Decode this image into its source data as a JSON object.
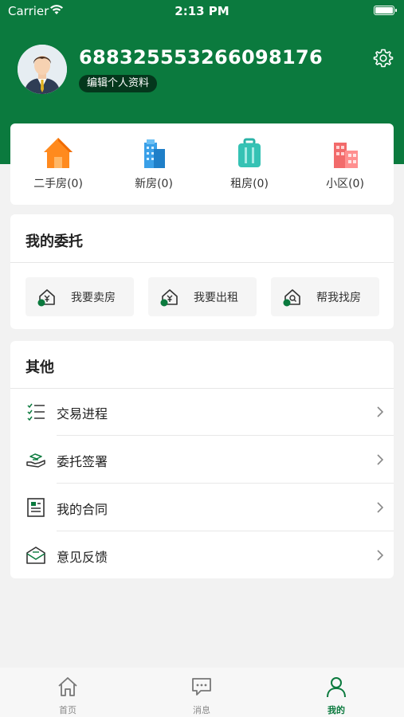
{
  "status_bar": {
    "carrier": "Carrier",
    "time": "2:13 PM"
  },
  "profile": {
    "user_id": "68832555326609817​6",
    "edit_label": "编辑个人资料"
  },
  "stats": [
    {
      "label": "二手房(0)",
      "icon": "house-icon"
    },
    {
      "label": "新房(0)",
      "icon": "building-icon"
    },
    {
      "label": "租房(0)",
      "icon": "suitcase-icon"
    },
    {
      "label": "小区(0)",
      "icon": "community-icon"
    }
  ],
  "entrust": {
    "title": "我的委托",
    "buttons": [
      {
        "label": "我要卖房"
      },
      {
        "label": "我要出租"
      },
      {
        "label": "帮我找房"
      }
    ]
  },
  "other": {
    "title": "其他",
    "items": [
      {
        "label": "交易进程",
        "icon": "checklist-icon"
      },
      {
        "label": "委托签署",
        "icon": "hand-icon"
      },
      {
        "label": "我的合同",
        "icon": "contract-icon"
      },
      {
        "label": "意见反馈",
        "icon": "mail-icon"
      }
    ]
  },
  "tabbar": [
    {
      "label": "首页",
      "icon": "home-icon"
    },
    {
      "label": "消息",
      "icon": "message-icon"
    },
    {
      "label": "我的",
      "icon": "user-icon",
      "active": true
    }
  ],
  "colors": {
    "brand": "#0b7a3e",
    "background": "#f2f2f2"
  }
}
